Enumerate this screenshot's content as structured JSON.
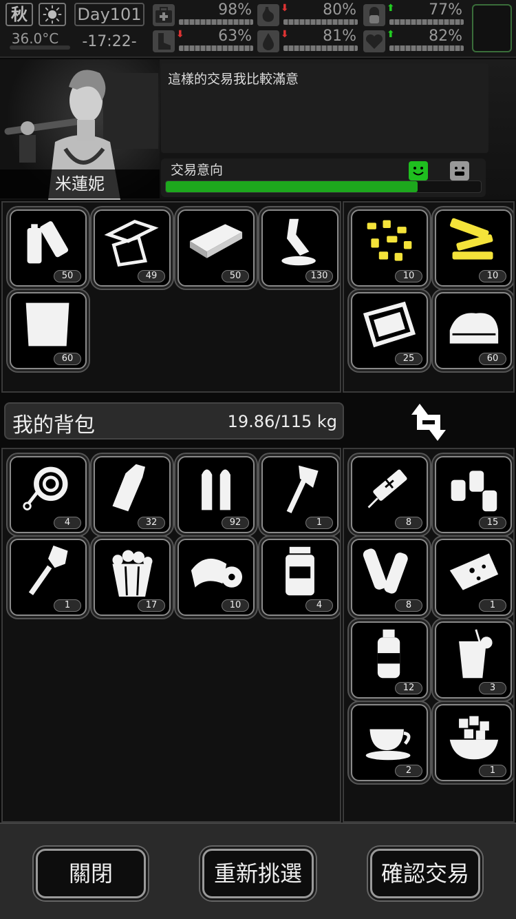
{
  "status": {
    "season": "秋",
    "temperature": "36.0°C",
    "day": "Day101",
    "time": "-17:22-",
    "stats": [
      {
        "name": "health",
        "percent": "98%",
        "trend": "none"
      },
      {
        "name": "hunger",
        "percent": "80%",
        "trend": "down"
      },
      {
        "name": "sleep",
        "percent": "77%",
        "trend": "up"
      },
      {
        "name": "stamina",
        "percent": "63%",
        "trend": "down"
      },
      {
        "name": "thirst",
        "percent": "81%",
        "trend": "down"
      },
      {
        "name": "mood",
        "percent": "82%",
        "trend": "up"
      }
    ]
  },
  "trader": {
    "name": "米蓮妮",
    "dialog": "這樣的交易我比較滿意",
    "intent_label": "交易意向",
    "intent_level": 0.8
  },
  "offer_left": [
    {
      "icon": "battery-icon",
      "count": "50"
    },
    {
      "icon": "scrap-metal-icon",
      "count": "49"
    },
    {
      "icon": "metal-bar-icon",
      "count": "50"
    },
    {
      "icon": "glue-icon",
      "count": "130"
    },
    {
      "icon": "cloth-icon",
      "count": "60"
    }
  ],
  "offer_right": [
    {
      "icon": "gold-nuggets-icon",
      "count": "10"
    },
    {
      "icon": "gold-parts-icon",
      "count": "10"
    },
    {
      "icon": "plastic-sheet-icon",
      "count": "25"
    },
    {
      "icon": "fabric-icon",
      "count": "60"
    }
  ],
  "backpack": {
    "title": "我的背包",
    "weight": "19.86/115 kg"
  },
  "bag_left": [
    {
      "icon": "rope-icon",
      "count": "4"
    },
    {
      "icon": "bottle-icon",
      "count": "32"
    },
    {
      "icon": "bullets-icon",
      "count": "92"
    },
    {
      "icon": "axe-icon",
      "count": "1"
    },
    {
      "icon": "shovel-icon",
      "count": "1"
    },
    {
      "icon": "popcorn-icon",
      "count": "17"
    },
    {
      "icon": "bandage-icon",
      "count": "10"
    },
    {
      "icon": "medicine-jar-icon",
      "count": "4"
    }
  ],
  "bag_right": [
    {
      "icon": "syringe-icon",
      "count": "8"
    },
    {
      "icon": "seasoning-bottles-icon",
      "count": "15"
    },
    {
      "icon": "wood-logs-icon",
      "count": "8"
    },
    {
      "icon": "cheese-icon",
      "count": "1"
    },
    {
      "icon": "sauce-bottle-icon",
      "count": "12"
    },
    {
      "icon": "juice-icon",
      "count": "3"
    },
    {
      "icon": "coffee-icon",
      "count": "2"
    },
    {
      "icon": "sugar-bowl-icon",
      "count": "1"
    }
  ],
  "buttons": {
    "close": "關閉",
    "reselect": "重新挑選",
    "confirm": "確認交易"
  }
}
